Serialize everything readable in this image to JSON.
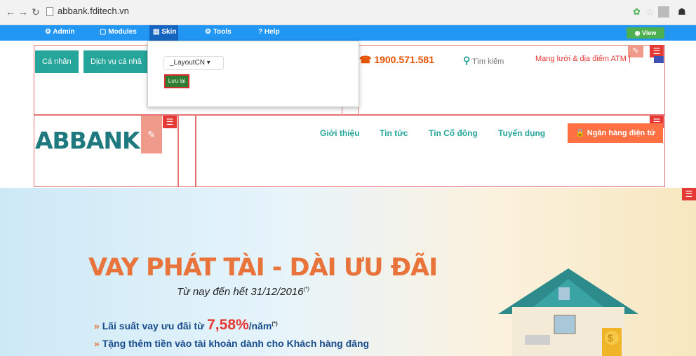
{
  "browser": {
    "url": "abbank.fditech.vn"
  },
  "admin_bar": {
    "items": [
      "Admin",
      "Modules",
      "Skin",
      "Tools",
      "? Help"
    ],
    "view": "View"
  },
  "top_nav": {
    "buttons": [
      "Cá nhân",
      "Dịch vụ cá nhâ"
    ],
    "phone": "1900.571.581",
    "search_placeholder": "Tìm kiếm",
    "network": "Mạng lưới & địa điểm ATM"
  },
  "dropdown": {
    "selected": "_LayoutCN",
    "save": "Lưu lại"
  },
  "header": {
    "logo": "ABBANK",
    "menu": [
      "Giới thiệu",
      "Tin tức",
      "Tin Cổ đông",
      "Tuyển dụng"
    ],
    "ebank": "Ngân hàng điện tử"
  },
  "banner": {
    "title": "VAY PHÁT TÀI - DÀI ƯU ĐÃI",
    "subtitle": "Từ nay đến hết 31/12/2016",
    "subtitle_mark": "(*)",
    "bullet1_prefix": "Lãi suất vay ưu đãi từ ",
    "bullet1_rate": "7,58%",
    "bullet1_suffix": "/năm",
    "bullet1_mark": "(*)",
    "bullet2": "Tặng thêm tiền vào tài khoản dành cho Khách hàng đăng"
  },
  "colors": {
    "admin_blue": "#2196f3",
    "teal": "#26a69a",
    "orange": "#ff7043",
    "red": "#e53935"
  }
}
